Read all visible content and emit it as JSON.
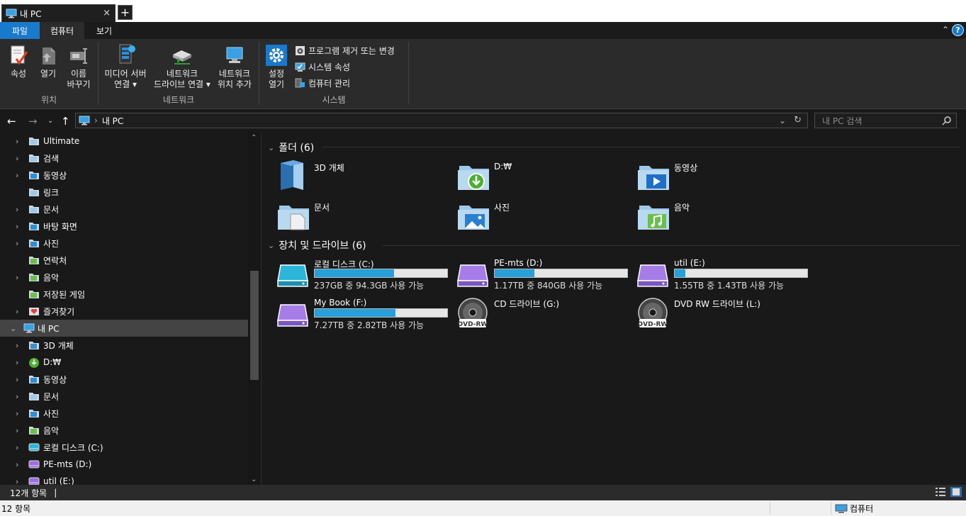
{
  "tab": {
    "title": "내 PC",
    "close": "×",
    "new": "+"
  },
  "menu": {
    "file": "파일",
    "computer": "컴퓨터",
    "view": "보기",
    "collapse": "⌃",
    "help": "?"
  },
  "ribbon": {
    "location": {
      "name": "위치",
      "properties": "속성",
      "open": "열기",
      "rename1": "이름",
      "rename2": "바꾸기"
    },
    "network": {
      "name": "네트워크",
      "media1": "미디어 서버",
      "media2": "연결",
      "map1": "네트워크",
      "map2": "드라이브 연결",
      "add1": "네트워크",
      "add2": "위치 추가"
    },
    "system": {
      "name": "시스템",
      "settings1": "설정",
      "settings2": "열기",
      "uninstall": "프로그램 제거 또는 변경",
      "sysprops": "시스템 속성",
      "manage": "컴퓨터 관리"
    }
  },
  "address": {
    "path": "내 PC",
    "search_placeholder": "내 PC 검색"
  },
  "nav": [
    {
      "label": "Ultimate",
      "chev": "›",
      "kind": "folder"
    },
    {
      "label": "검색",
      "chev": "›",
      "kind": "search"
    },
    {
      "label": "동영상",
      "chev": "›",
      "kind": "video"
    },
    {
      "label": "링크",
      "chev": "",
      "kind": "link"
    },
    {
      "label": "문서",
      "chev": "›",
      "kind": "doc"
    },
    {
      "label": "바탕 화면",
      "chev": "›",
      "kind": "desktop"
    },
    {
      "label": "사진",
      "chev": "›",
      "kind": "pic"
    },
    {
      "label": "연락처",
      "chev": "",
      "kind": "contact"
    },
    {
      "label": "음악",
      "chev": "›",
      "kind": "music"
    },
    {
      "label": "저장된 게임",
      "chev": "",
      "kind": "game"
    },
    {
      "label": "즐겨찾기",
      "chev": "›",
      "kind": "fav"
    },
    {
      "label": "내 PC",
      "chev": "⌄",
      "kind": "pc",
      "selected": true
    },
    {
      "label": "3D 개체",
      "chev": "›",
      "kind": "3d"
    },
    {
      "label": "D:₩",
      "chev": "›",
      "kind": "dl"
    },
    {
      "label": "동영상",
      "chev": "›",
      "kind": "video"
    },
    {
      "label": "문서",
      "chev": "›",
      "kind": "doc"
    },
    {
      "label": "사진",
      "chev": "›",
      "kind": "pic"
    },
    {
      "label": "음악",
      "chev": "›",
      "kind": "music"
    },
    {
      "label": "로컬 디스크 (C:)",
      "chev": "›",
      "kind": "drivec"
    },
    {
      "label": "PE-mts (D:)",
      "chev": "›",
      "kind": "drivep"
    },
    {
      "label": "util (E:)",
      "chev": "›",
      "kind": "drivep"
    }
  ],
  "folders": {
    "header": "폴더 (6)",
    "items": [
      {
        "label": "3D 개체",
        "kind": "3d"
      },
      {
        "label": "D:₩",
        "kind": "dl"
      },
      {
        "label": "동영상",
        "kind": "video"
      },
      {
        "label": "문서",
        "kind": "doc"
      },
      {
        "label": "사진",
        "kind": "pic"
      },
      {
        "label": "음악",
        "kind": "music"
      }
    ]
  },
  "drives": {
    "header": "장치 및 드라이브 (6)",
    "items": [
      {
        "name": "로컬 디스크 (C:)",
        "free": "237GB 중 94.3GB 사용 가능",
        "used": 0.6,
        "kind": "cyan"
      },
      {
        "name": "PE-mts (D:)",
        "free": "1.17TB 중 840GB 사용 가능",
        "used": 0.3,
        "kind": "purple"
      },
      {
        "name": "util (E:)",
        "free": "1.55TB 중 1.43TB 사용 가능",
        "used": 0.08,
        "kind": "purple"
      },
      {
        "name": "My Book (F:)",
        "free": "7.27TB 중 2.82TB 사용 가능",
        "used": 0.61,
        "kind": "purple"
      },
      {
        "name": "CD 드라이브 (G:)",
        "free": "",
        "used": null,
        "kind": "dvd"
      },
      {
        "name": "DVD RW 드라이브 (L:)",
        "free": "",
        "used": null,
        "kind": "dvd"
      }
    ]
  },
  "status": {
    "count": "12개 항목",
    "cursor": "|",
    "count2": "12 항목",
    "computer": "컴퓨터"
  },
  "colors": {
    "accent": "#1979ca",
    "bar": "#26a0da",
    "bg": "#191919"
  }
}
